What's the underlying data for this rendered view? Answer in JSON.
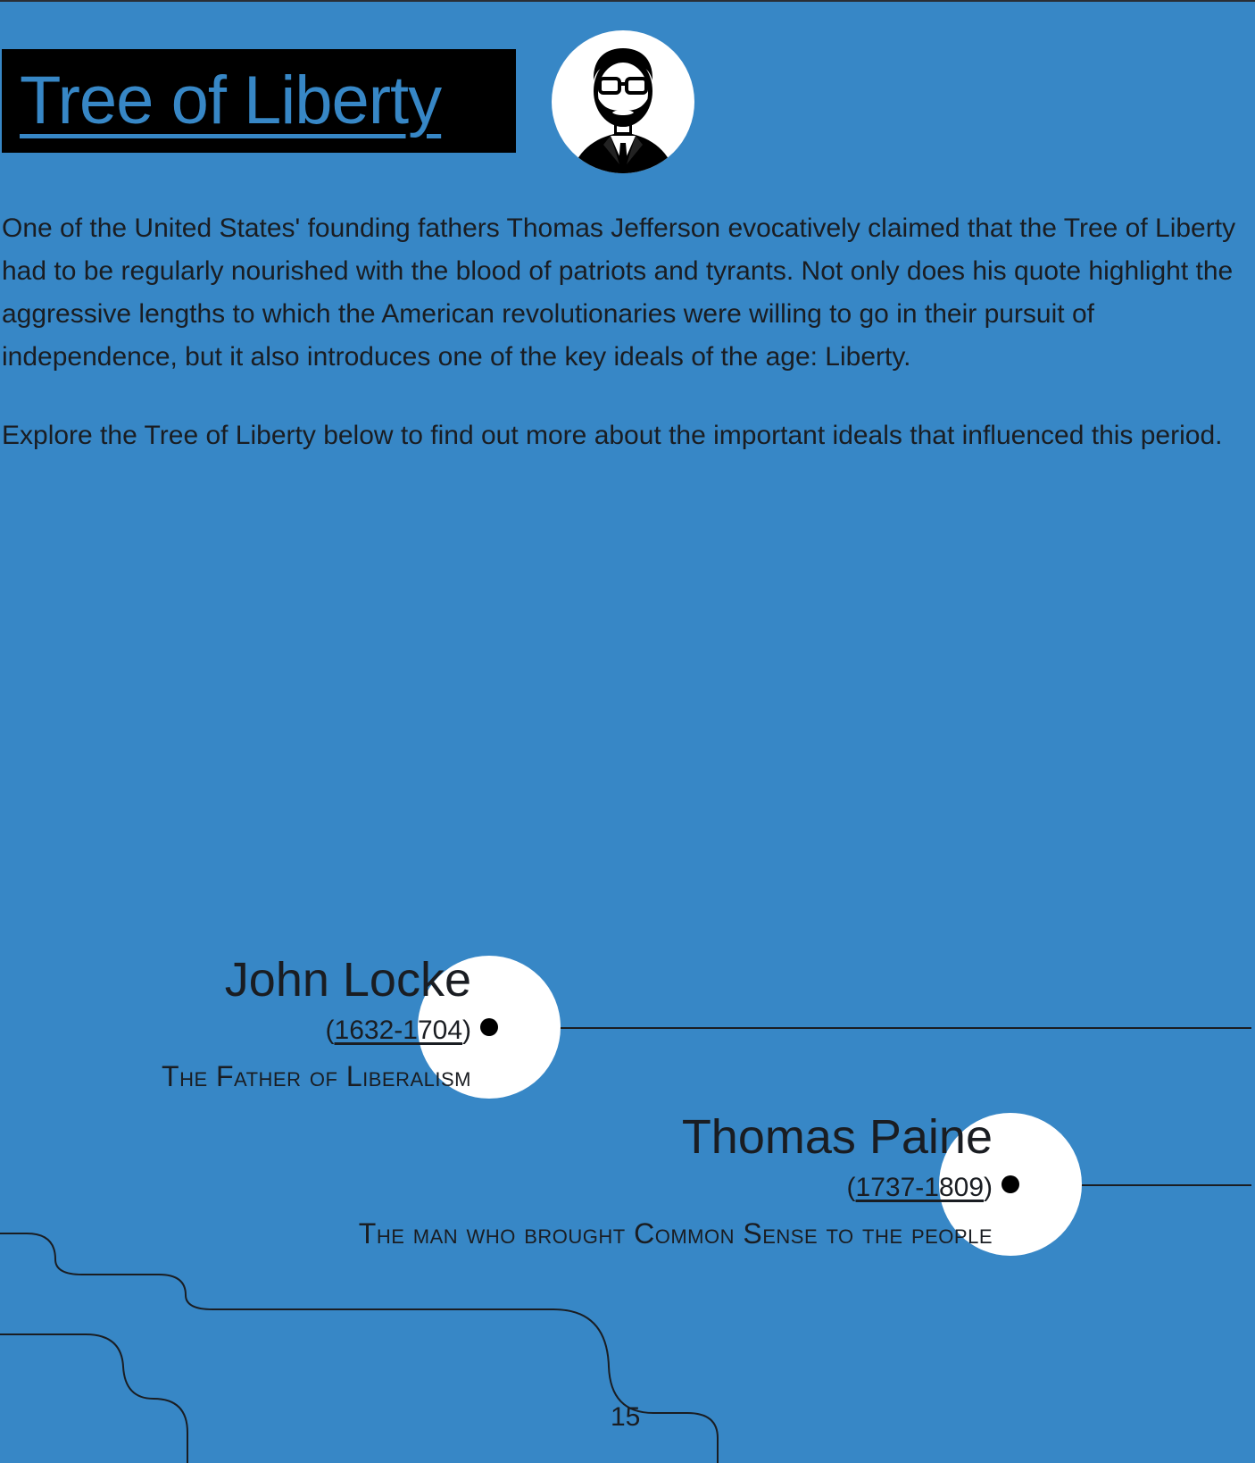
{
  "title": "Tree of Liberty",
  "avatar_icon": "bearded-man-with-glasses-avatar-icon",
  "intro": {
    "paragraph_1": "One of the United States' founding fathers Thomas Jefferson evocatively claimed that the Tree of Liberty had to be regularly nourished with the blood of patriots and tyrants. Not only does his quote highlight the aggressive lengths to which the American revolutionaries were willing to go in their pursuit of independence, but it also introduces one of the key ideals of the age: Liberty.",
    "paragraph_2": "Explore the Tree of Liberty below to find out more about the important ideals that influenced this period."
  },
  "people": [
    {
      "name": "John Locke",
      "years_open": "(",
      "years": "1632-1704",
      "years_close": ")",
      "epithet": "The Father of Liberalism"
    },
    {
      "name": "Thomas Paine",
      "years_open": "(",
      "years": "1737-1809",
      "years_close": ")",
      "epithet": "The man who brought Common Sense to the people"
    }
  ],
  "page_number": "15",
  "colors": {
    "background": "#3787c6",
    "title_box": "#000000",
    "title_text": "#3787c6",
    "text": "#1a1d22",
    "node_circle": "#ffffff",
    "node_dot": "#000000"
  }
}
